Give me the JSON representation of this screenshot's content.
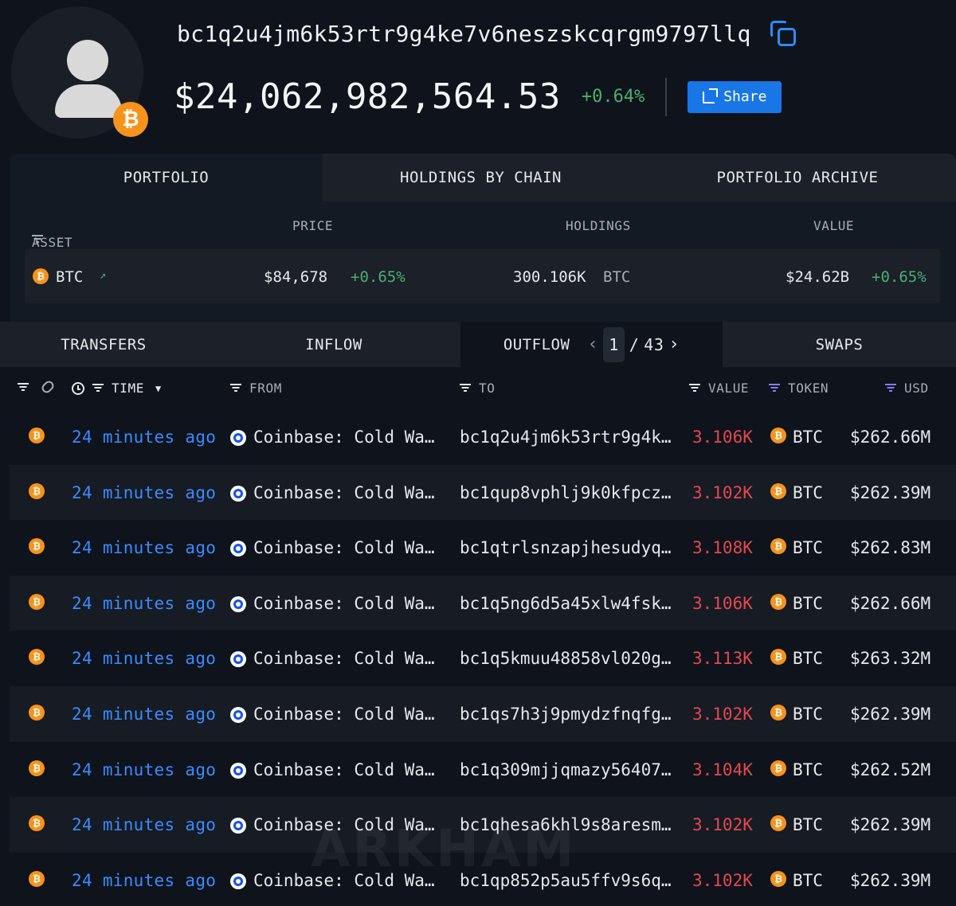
{
  "header": {
    "address": "bc1q2u4jm6k53rtr9g4ke7v6neszskcqrgm9797llq",
    "total_value": "$24,062,982,564.53",
    "total_change": "+0.64%",
    "share_label": "Share",
    "badge_symbol": "₿"
  },
  "portfolio_tabs": [
    "PORTFOLIO",
    "HOLDINGS BY CHAIN",
    "PORTFOLIO ARCHIVE"
  ],
  "portfolio_columns": {
    "asset": "ASSET",
    "price": "PRICE",
    "holdings": "HOLDINGS",
    "value": "VALUE"
  },
  "portfolio_row": {
    "asset": "BTC",
    "price": "$84,678",
    "price_change": "+0.65%",
    "holdings": "300.106K",
    "holdings_unit": "BTC",
    "value": "$24.62B",
    "value_change": "+0.65%"
  },
  "transfer_tabs": {
    "transfers": "TRANSFERS",
    "inflow": "INFLOW",
    "outflow": "OUTFLOW",
    "swaps": "SWAPS",
    "page_current": "1",
    "page_separator": "/",
    "page_total": "43"
  },
  "transfer_columns": {
    "time": "TIME",
    "from": "FROM",
    "to": "TO",
    "value": "VALUE",
    "token": "TOKEN",
    "usd": "USD"
  },
  "transfers": [
    {
      "time": "24 minutes ago",
      "from": "Coinbase: Cold Wa…",
      "to": "bc1q2u4jm6k53rtr9g4k…",
      "value": "3.106K",
      "token": "BTC",
      "usd": "$262.66M"
    },
    {
      "time": "24 minutes ago",
      "from": "Coinbase: Cold Wa…",
      "to": "bc1qup8vphlj9k0kfpcz…",
      "value": "3.102K",
      "token": "BTC",
      "usd": "$262.39M"
    },
    {
      "time": "24 minutes ago",
      "from": "Coinbase: Cold Wa…",
      "to": "bc1qtrlsnzapjhesudyq…",
      "value": "3.108K",
      "token": "BTC",
      "usd": "$262.83M"
    },
    {
      "time": "24 minutes ago",
      "from": "Coinbase: Cold Wa…",
      "to": "bc1q5ng6d5a45xlw4fsk…",
      "value": "3.106K",
      "token": "BTC",
      "usd": "$262.66M"
    },
    {
      "time": "24 minutes ago",
      "from": "Coinbase: Cold Wa…",
      "to": "bc1q5kmuu48858vl020g…",
      "value": "3.113K",
      "token": "BTC",
      "usd": "$263.32M"
    },
    {
      "time": "24 minutes ago",
      "from": "Coinbase: Cold Wa…",
      "to": "bc1qs7h3j9pmydzfnqfg…",
      "value": "3.102K",
      "token": "BTC",
      "usd": "$262.39M"
    },
    {
      "time": "24 minutes ago",
      "from": "Coinbase: Cold Wa…",
      "to": "bc1q309mjjqmazy56407…",
      "value": "3.104K",
      "token": "BTC",
      "usd": "$262.52M"
    },
    {
      "time": "24 minutes ago",
      "from": "Coinbase: Cold Wa…",
      "to": "bc1qhesa6khl9s8aresm…",
      "value": "3.102K",
      "token": "BTC",
      "usd": "$262.39M"
    },
    {
      "time": "24 minutes ago",
      "from": "Coinbase: Cold Wa…",
      "to": "bc1qp852p5au5ffv9s6q…",
      "value": "3.102K",
      "token": "BTC",
      "usd": "$262.39M"
    }
  ],
  "watermark": "ARKHAM",
  "colors": {
    "accent": "#1976e6",
    "btc": "#f7931a",
    "positive": "#4caf6e",
    "negative": "#e5484d",
    "link": "#3b8bff"
  },
  "icons": [
    "user-avatar-icon",
    "bitcoin-icon",
    "copy-icon",
    "share-icon",
    "filter-icon",
    "trend-up-icon",
    "link-icon",
    "clock-icon",
    "coinbase-icon"
  ]
}
